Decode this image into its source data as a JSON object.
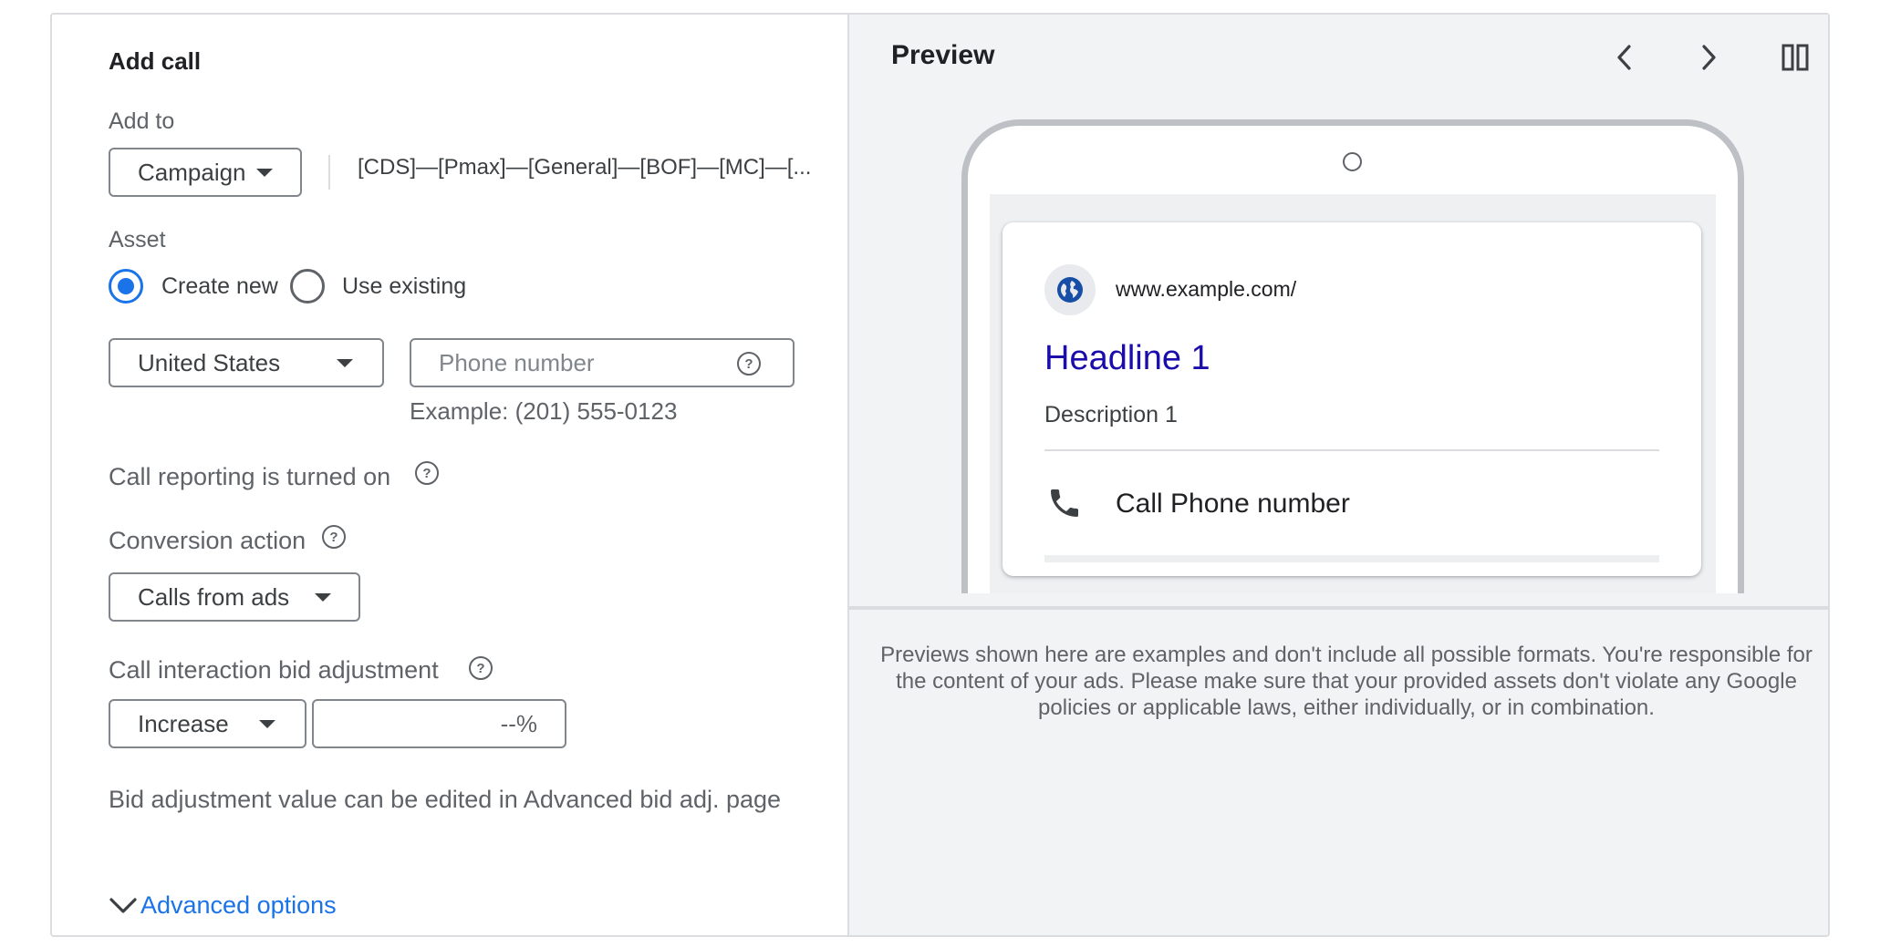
{
  "dialog": {
    "title": "Add call",
    "add_to_label": "Add to",
    "add_to_dropdown": "Campaign",
    "campaign_name": "[CDS]—[Pmax]—[General]—[BOF]—[MC]—[...",
    "asset_label": "Asset",
    "radio_options": [
      {
        "label": "Create new",
        "selected": true
      },
      {
        "label": "Use existing",
        "selected": false
      }
    ],
    "country": "United States",
    "phone_placeholder": "Phone number",
    "phone_example": "Example: (201) 555-0123",
    "call_reporting_text": "Call reporting is turned on",
    "conversion_action_label": "Conversion action",
    "conversion_action_value": "Calls from ads",
    "bid_adjustment_label": "Call interaction bid adjustment",
    "bid_direction": "Increase",
    "bid_value_placeholder": "--%",
    "bid_note": "Bid adjustment value can be edited in Advanced bid adj. page",
    "advanced_options": "Advanced options"
  },
  "preview": {
    "title": "Preview",
    "url": "www.example.com/",
    "headline": "Headline 1",
    "description": "Description 1",
    "call_text": "Call Phone number",
    "disclaimer": "Previews shown here are examples and don't include all possible formats. You're responsible for the content of your ads. Please make sure that your provided assets don't violate any Google policies or applicable laws, either individually, or in combination."
  },
  "colors": {
    "accent": "#1a73e8",
    "preview_bg": "#f1f3f4",
    "headline": "#1a0dab"
  },
  "icons": [
    "chevron-left-icon",
    "chevron-right-icon",
    "split-view-icon",
    "globe-icon",
    "phone-icon",
    "help-icon",
    "caret-down-icon",
    "chevron-down-icon"
  ]
}
